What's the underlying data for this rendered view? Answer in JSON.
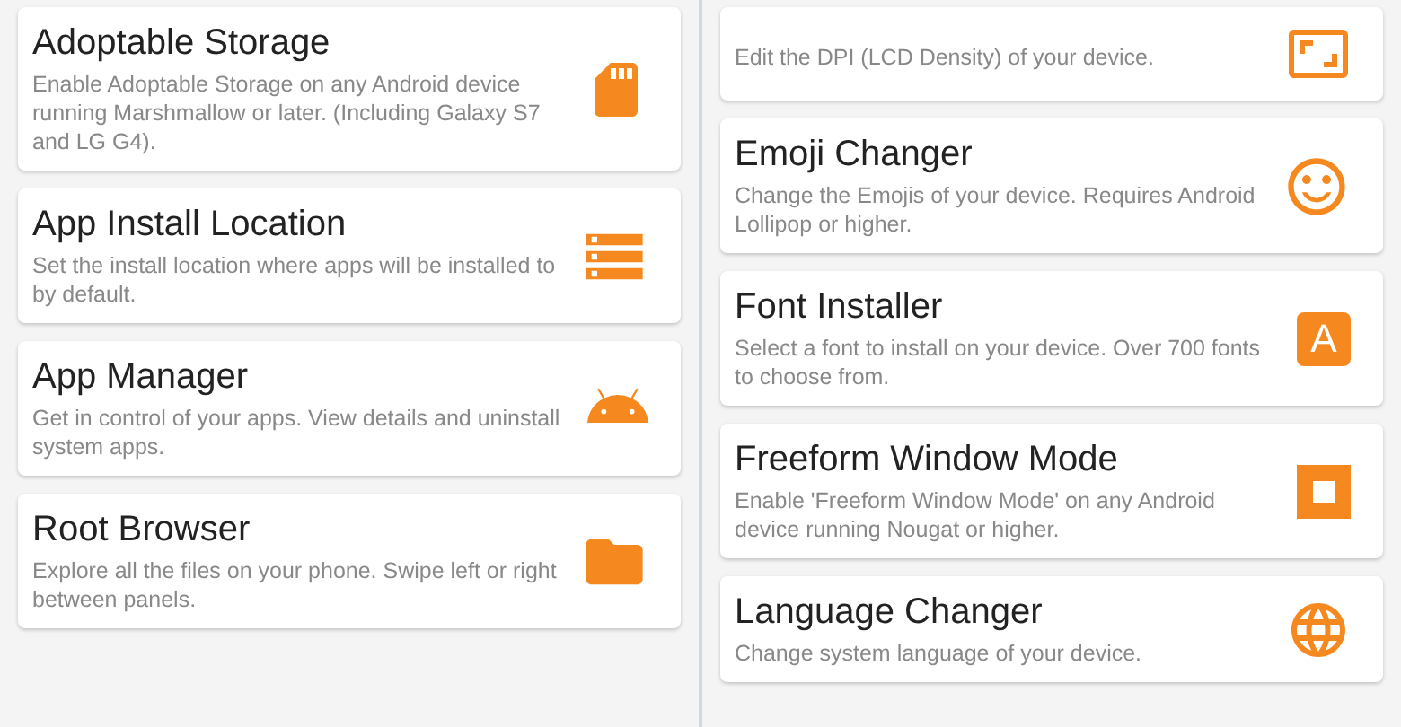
{
  "columns": [
    {
      "cards": [
        {
          "title": "Adoptable Storage",
          "description": "Enable Adoptable Storage on any Android device running Marshmallow or later. (Including Galaxy S7 and LG G4).",
          "kind": "card"
        },
        {
          "title": "App Install Location",
          "description": "Set the install location where apps will be installed to by default.",
          "kind": "card"
        },
        {
          "title": "App Manager",
          "description": "Get in control of your apps. View details and uninstall system apps.",
          "kind": "card"
        },
        {
          "title": "Root Browser",
          "description": "Explore all the files on your phone. Swipe left or right between panels.",
          "kind": "card"
        }
      ]
    },
    {
      "cards": [
        {
          "description": "Edit the DPI (LCD Density) of your device.",
          "kind": "card"
        },
        {
          "title": "Emoji Changer",
          "description": "Change the Emojis of your device. Requires Android Lollipop or higher.",
          "kind": "card"
        },
        {
          "title": "Font Installer",
          "description": "Select a font to install on your device. Over 700 fonts to choose from.",
          "kind": "card",
          "icon_letter": "A"
        },
        {
          "title": "Freeform Window Mode",
          "description": "Enable 'Freeform Window Mode' on any Android device running Nougat or higher.",
          "kind": "card"
        },
        {
          "title": "Language Changer",
          "description": "Change system language of your device.",
          "kind": "card"
        }
      ]
    }
  ]
}
